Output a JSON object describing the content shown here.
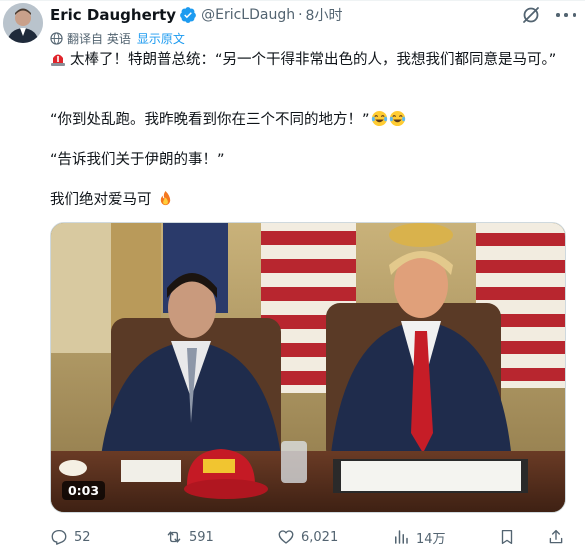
{
  "post": {
    "author": {
      "name": "Eric Daugherty",
      "handle": "@EricLDaugh",
      "separator": "·",
      "time": "8小时",
      "verified": true,
      "avatar": "avatar"
    },
    "translation": {
      "note": "翻译自 英语",
      "show_original": "显示原文"
    },
    "paragraphs": {
      "p1_icon": "siren-emoji",
      "p1": "太棒了！特朗普总统：“另一个干得非常出色的人，我想我们都同意是马可。”",
      "p2": "“你到处乱跑。我昨晚看到你在三个不同的地方！”",
      "p2_icon": "laughing-tears-emoji ×2",
      "p3": "“告诉我们关于伊朗的事！”",
      "p4": "我们绝对爱马可",
      "p4_icon": "fire-emoji"
    },
    "media": {
      "type": "video",
      "duration": "0:03"
    },
    "actions": {
      "replies": "52",
      "retweets": "591",
      "likes": "6,021",
      "views": "14万"
    }
  },
  "colors": {
    "text": "#0f1419",
    "secondary": "#536471",
    "link": "#1d9bf0",
    "verified": "#1d9bf0"
  }
}
